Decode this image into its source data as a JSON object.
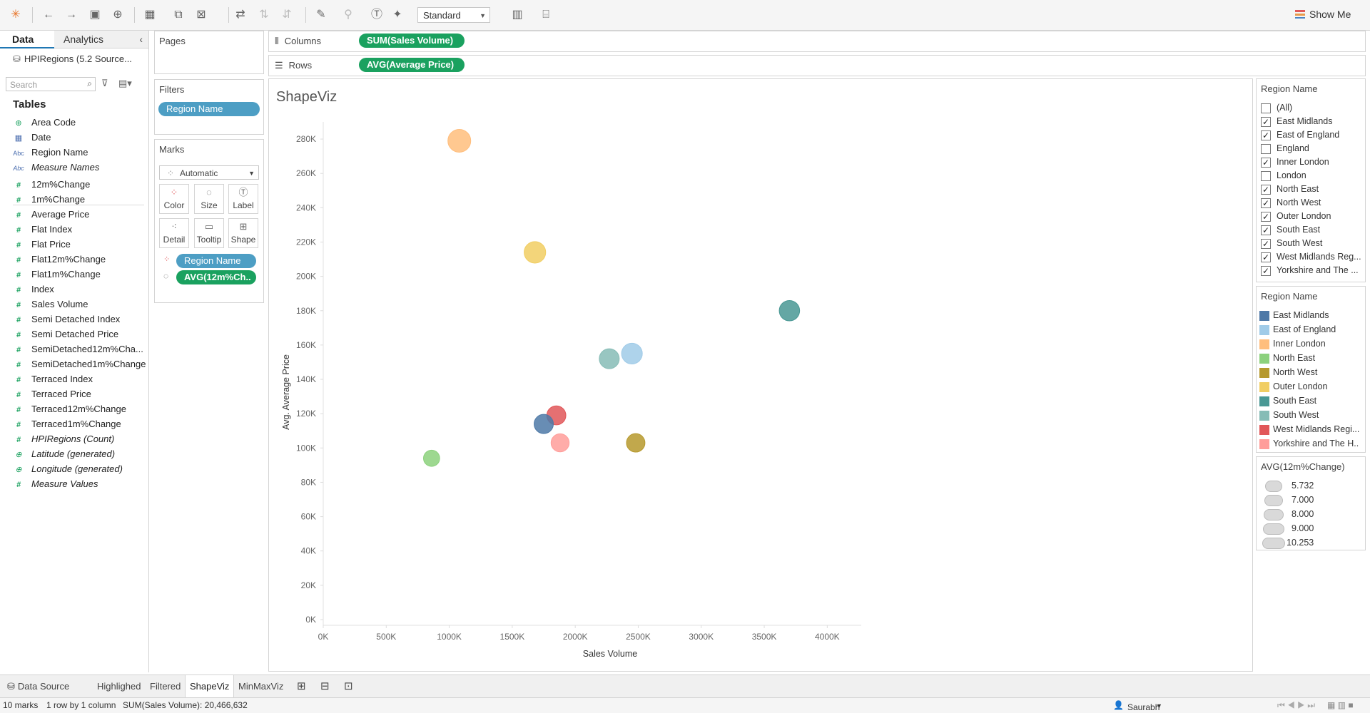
{
  "toolbar": {
    "view_mode": "Standard",
    "show_me": "Show Me"
  },
  "left_pane": {
    "tab_data": "Data",
    "tab_analytics": "Analytics",
    "data_source": "HPIRegions (5.2 Source...",
    "search_placeholder": "Search",
    "tables_heading": "Tables",
    "fields": [
      {
        "name": "Area Code",
        "kind": "geo"
      },
      {
        "name": "Date",
        "kind": "date"
      },
      {
        "name": "Region Name",
        "kind": "dim"
      },
      {
        "name": "Measure Names",
        "kind": "dim"
      },
      {
        "name": "12m%Change",
        "kind": "meas"
      },
      {
        "name": "1m%Change",
        "kind": "meas"
      },
      {
        "name": "Average Price",
        "kind": "meas"
      },
      {
        "name": "Flat Index",
        "kind": "meas"
      },
      {
        "name": "Flat Price",
        "kind": "meas"
      },
      {
        "name": "Flat12m%Change",
        "kind": "meas"
      },
      {
        "name": "Flat1m%Change",
        "kind": "meas"
      },
      {
        "name": "Index",
        "kind": "meas"
      },
      {
        "name": "Sales Volume",
        "kind": "meas"
      },
      {
        "name": "Semi Detached Index",
        "kind": "meas"
      },
      {
        "name": "Semi Detached Price",
        "kind": "meas"
      },
      {
        "name": "SemiDetached12m%Cha...",
        "kind": "meas"
      },
      {
        "name": "SemiDetached1m%Change",
        "kind": "meas"
      },
      {
        "name": "Terraced Index",
        "kind": "meas"
      },
      {
        "name": "Terraced Price",
        "kind": "meas"
      },
      {
        "name": "Terraced12m%Change",
        "kind": "meas"
      },
      {
        "name": "Terraced1m%Change",
        "kind": "meas"
      },
      {
        "name": "HPIRegions (Count)",
        "kind": "meas"
      },
      {
        "name": "Latitude (generated)",
        "kind": "geo"
      },
      {
        "name": "Longitude (generated)",
        "kind": "geo"
      },
      {
        "name": "Measure Values",
        "kind": "meas"
      }
    ]
  },
  "pages": {
    "title": "Pages"
  },
  "filters": {
    "title": "Filters",
    "pill": "Region Name"
  },
  "marks": {
    "title": "Marks",
    "type": "Automatic",
    "buttons": [
      "Color",
      "Size",
      "Label",
      "Detail",
      "Tooltip",
      "Shape"
    ],
    "color_pill": "Region Name",
    "size_pill": "AVG(12m%Ch.."
  },
  "shelves": {
    "columns_label": "Columns",
    "columns_pill": "SUM(Sales Volume)",
    "rows_label": "Rows",
    "rows_pill": "AVG(Average Price)"
  },
  "viz": {
    "title": "ShapeViz"
  },
  "filter_card": {
    "title": "Region Name",
    "items": [
      {
        "label": "(All)",
        "checked": false
      },
      {
        "label": "East Midlands",
        "checked": true
      },
      {
        "label": "East of England",
        "checked": true
      },
      {
        "label": "England",
        "checked": false
      },
      {
        "label": "Inner London",
        "checked": true
      },
      {
        "label": "London",
        "checked": false
      },
      {
        "label": "North East",
        "checked": true
      },
      {
        "label": "North West",
        "checked": true
      },
      {
        "label": "Outer London",
        "checked": true
      },
      {
        "label": "South East",
        "checked": true
      },
      {
        "label": "South West",
        "checked": true
      },
      {
        "label": "West Midlands Reg...",
        "checked": true
      },
      {
        "label": "Yorkshire and The ...",
        "checked": true
      }
    ]
  },
  "color_legend": {
    "title": "Region Name",
    "items": [
      {
        "label": "East Midlands",
        "color": "#4e79a7"
      },
      {
        "label": "East of England",
        "color": "#a0cbe8"
      },
      {
        "label": "Inner London",
        "color": "#ffbe7d"
      },
      {
        "label": "North East",
        "color": "#8cd17d"
      },
      {
        "label": "North West",
        "color": "#b6992d"
      },
      {
        "label": "Outer London",
        "color": "#f1ce63"
      },
      {
        "label": "South East",
        "color": "#499894"
      },
      {
        "label": "South West",
        "color": "#86bcb6"
      },
      {
        "label": "West Midlands Regi...",
        "color": "#e15759"
      },
      {
        "label": "Yorkshire and The H..",
        "color": "#ff9d9a"
      }
    ]
  },
  "size_legend": {
    "title": "AVG(12m%Change)",
    "items": [
      "5.732",
      "7.000",
      "8.000",
      "9.000",
      "10.253"
    ]
  },
  "chart_data": {
    "type": "scatter",
    "title": "ShapeViz",
    "xlabel": "Sales Volume",
    "ylabel": "Avg. Average Price",
    "xlim": [
      0,
      4100000
    ],
    "ylim": [
      0,
      290000
    ],
    "x_ticks": [
      "0K",
      "500K",
      "1000K",
      "1500K",
      "2000K",
      "2500K",
      "3000K",
      "3500K",
      "4000K"
    ],
    "y_ticks": [
      "0K",
      "20K",
      "40K",
      "60K",
      "80K",
      "100K",
      "120K",
      "140K",
      "160K",
      "180K",
      "200K",
      "220K",
      "240K",
      "260K",
      "280K"
    ],
    "points": [
      {
        "region": "Inner London",
        "x": 1080000,
        "y": 279000,
        "size": 9.5,
        "color": "#ffbe7d"
      },
      {
        "region": "Outer London",
        "x": 1680000,
        "y": 214000,
        "size": 8.8,
        "color": "#f1ce63"
      },
      {
        "region": "South East",
        "x": 3700000,
        "y": 180000,
        "size": 8.2,
        "color": "#499894"
      },
      {
        "region": "East of England",
        "x": 2450000,
        "y": 155000,
        "size": 8.4,
        "color": "#a0cbe8"
      },
      {
        "region": "South West",
        "x": 2270000,
        "y": 152000,
        "size": 8.0,
        "color": "#86bcb6"
      },
      {
        "region": "West Midlands Region",
        "x": 1850000,
        "y": 119000,
        "size": 7.5,
        "color": "#e15759"
      },
      {
        "region": "East Midlands",
        "x": 1750000,
        "y": 114000,
        "size": 7.6,
        "color": "#4e79a7"
      },
      {
        "region": "Yorkshire and The Humber",
        "x": 1880000,
        "y": 103000,
        "size": 7.0,
        "color": "#ff9d9a"
      },
      {
        "region": "North West",
        "x": 2480000,
        "y": 103000,
        "size": 7.2,
        "color": "#b6992d"
      },
      {
        "region": "North East",
        "x": 860000,
        "y": 94000,
        "size": 6.0,
        "color": "#8cd17d"
      }
    ]
  },
  "bottom_tabs": [
    "Data Source",
    "Highlighed",
    "Filtered",
    "ShapeViz",
    "MinMaxViz"
  ],
  "status": {
    "marks": "10 marks",
    "rows_cols": "1 row by 1 column",
    "sum": "SUM(Sales Volume): 20,466,632",
    "user": "Saurabh"
  }
}
